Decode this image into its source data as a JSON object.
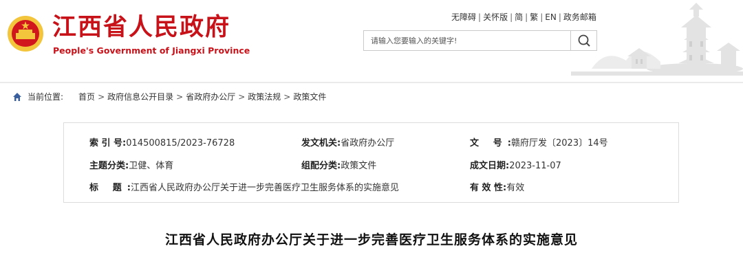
{
  "header": {
    "title": "江西省人民政府",
    "subtitle": "People's Government of Jiangxi Province",
    "toplinks": [
      "无障碍",
      "关怀版",
      "简",
      "繁",
      "EN",
      "政务邮箱"
    ],
    "search": {
      "placeholder": "请输入您要输入的关键字!"
    }
  },
  "breadcrumb": {
    "label": "当前位置:",
    "items": [
      "首页",
      "政府信息公开目录",
      "省政府办公厅",
      "政策法规",
      "政策文件"
    ],
    "separator": ">"
  },
  "meta": {
    "index_no": {
      "label": "索 引 号:",
      "value": "014500815/2023-76728"
    },
    "issuer": {
      "label": "发文机关:",
      "value": "省政府办公厅"
    },
    "doc_no": {
      "label": "文 号:",
      "value": "赣府厅发〔2023〕14号"
    },
    "topic": {
      "label": "主题分类:",
      "value": "卫健、体育"
    },
    "category": {
      "label": "组配分类:",
      "value": "政策文件"
    },
    "date": {
      "label": "成文日期:",
      "value": "2023-11-07"
    },
    "title": {
      "label": "标 题:",
      "value": "江西省人民政府办公厅关于进一步完善医疗卫生服务体系的实施意见"
    },
    "validity": {
      "label": "有 效 性:",
      "value": "有效"
    }
  },
  "document": {
    "title": "江西省人民政府办公厅关于进一步完善医疗卫生服务体系的实施意见"
  },
  "colors": {
    "brand_red": "#c8121a",
    "emblem_gold": "#f2c53d"
  },
  "icons": {
    "emblem": "national-emblem-icon",
    "search": "search-icon",
    "home": "home-icon",
    "skyline": "pavilion-skyline-icon"
  }
}
